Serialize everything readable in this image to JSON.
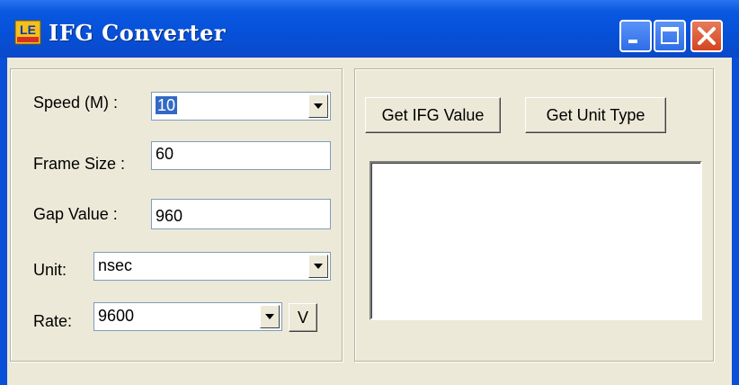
{
  "window": {
    "title": "IFG Converter",
    "icon_text": "LE",
    "controls": {
      "minimize": "minimize-icon",
      "maximize": "maximize-icon",
      "close": "close-icon"
    }
  },
  "form": {
    "speed_label": "Speed (M) :",
    "speed_value": "10",
    "frame_size_label": "Frame Size :",
    "frame_size_value": "60",
    "gap_value_label": "Gap Value :",
    "gap_value_value": "960",
    "unit_label": "Unit:",
    "unit_value": "nsec",
    "rate_label": "Rate:",
    "rate_value": "9600",
    "v_button": "V"
  },
  "actions": {
    "get_ifg_value": "Get IFG Value",
    "get_unit_type": "Get Unit Type"
  },
  "colors": {
    "title_bar": "#0a58e0",
    "face": "#ece9d8",
    "selection": "#316ac5",
    "close": "#d2461f"
  }
}
